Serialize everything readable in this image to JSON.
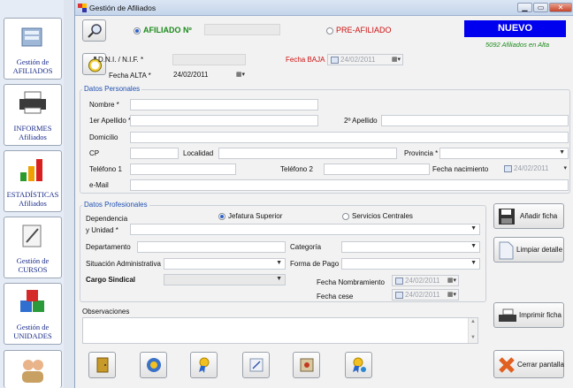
{
  "window": {
    "title": "Gestión de Afiliados"
  },
  "sidebar": {
    "items": [
      {
        "line1": "Gestión de",
        "line2": "AFILIADOS"
      },
      {
        "line1": "INFORMES",
        "line2": "Afiliados"
      },
      {
        "line1": "ESTADÍSTICAS",
        "line2": "Afiliados"
      },
      {
        "line1": "Gestión de",
        "line2": "CURSOS"
      },
      {
        "line1": "Gestión de",
        "line2": "UNIDADES"
      }
    ]
  },
  "header": {
    "afiliado_label": "AFILIADO Nº",
    "preafiliado_label": "PRE-AFILIADO",
    "nuevo_badge": "NUEVO",
    "alta_count": "5092 Afiliados en Alta",
    "dni_label": "D.N.I. / N.I.F. *",
    "fecha_baja_label": "Fecha BAJA",
    "fecha_baja_value": "24/02/2011",
    "fecha_alta_label": "Fecha ALTA *",
    "fecha_alta_value": "24/02/2011"
  },
  "personal": {
    "group_title": "Datos Personales",
    "nombre": "Nombre *",
    "apellido1": "1er Apellido *",
    "apellido2": "2º Apellido",
    "domicilio": "Domicilio",
    "cp": "CP",
    "localidad": "Localidad",
    "provincia": "Provincia *",
    "telefono1": "Teléfono 1",
    "telefono2": "Teléfono 2",
    "fecha_nac": "Fecha nacimiento",
    "fecha_nac_value": "24/02/2011",
    "email": "e-Mail"
  },
  "profesional": {
    "group_title": "Datos Profesionales",
    "dependencia": "Dependencia",
    "unidad": "y Unidad *",
    "jefatura": "Jefatura Superior",
    "servicios": "Servicios Centrales",
    "departamento": "Departamento",
    "categoria": "Categoría",
    "situacion": "Situación Administrativa",
    "forma_pago": "Forma de Pago",
    "cargo": "Cargo Sindical",
    "fecha_nombramiento": "Fecha Nombramiento",
    "fecha_nombramiento_value": "24/02/2011",
    "fecha_cese": "Fecha cese",
    "fecha_cese_value": "24/02/2011"
  },
  "observaciones": {
    "label": "Observaciones"
  },
  "actions": {
    "anadir": "Añadir ficha",
    "limpiar": "Limpiar detalle",
    "imprimir": "Imprimir ficha",
    "cerrar": "Cerrar pantalla"
  },
  "colors": {
    "accent": "#2050b0",
    "nuevo_bg": "#0000ee",
    "required_red": "#cc1010",
    "alta_green": "#1a8a1a"
  },
  "icons": [
    "search-icon",
    "stopwatch-icon",
    "door-icon",
    "info-icon",
    "award-icon",
    "note-icon",
    "safe-icon",
    "award-user-icon",
    "floppy-icon",
    "clean-icon",
    "printer-icon",
    "close-x-icon"
  ]
}
